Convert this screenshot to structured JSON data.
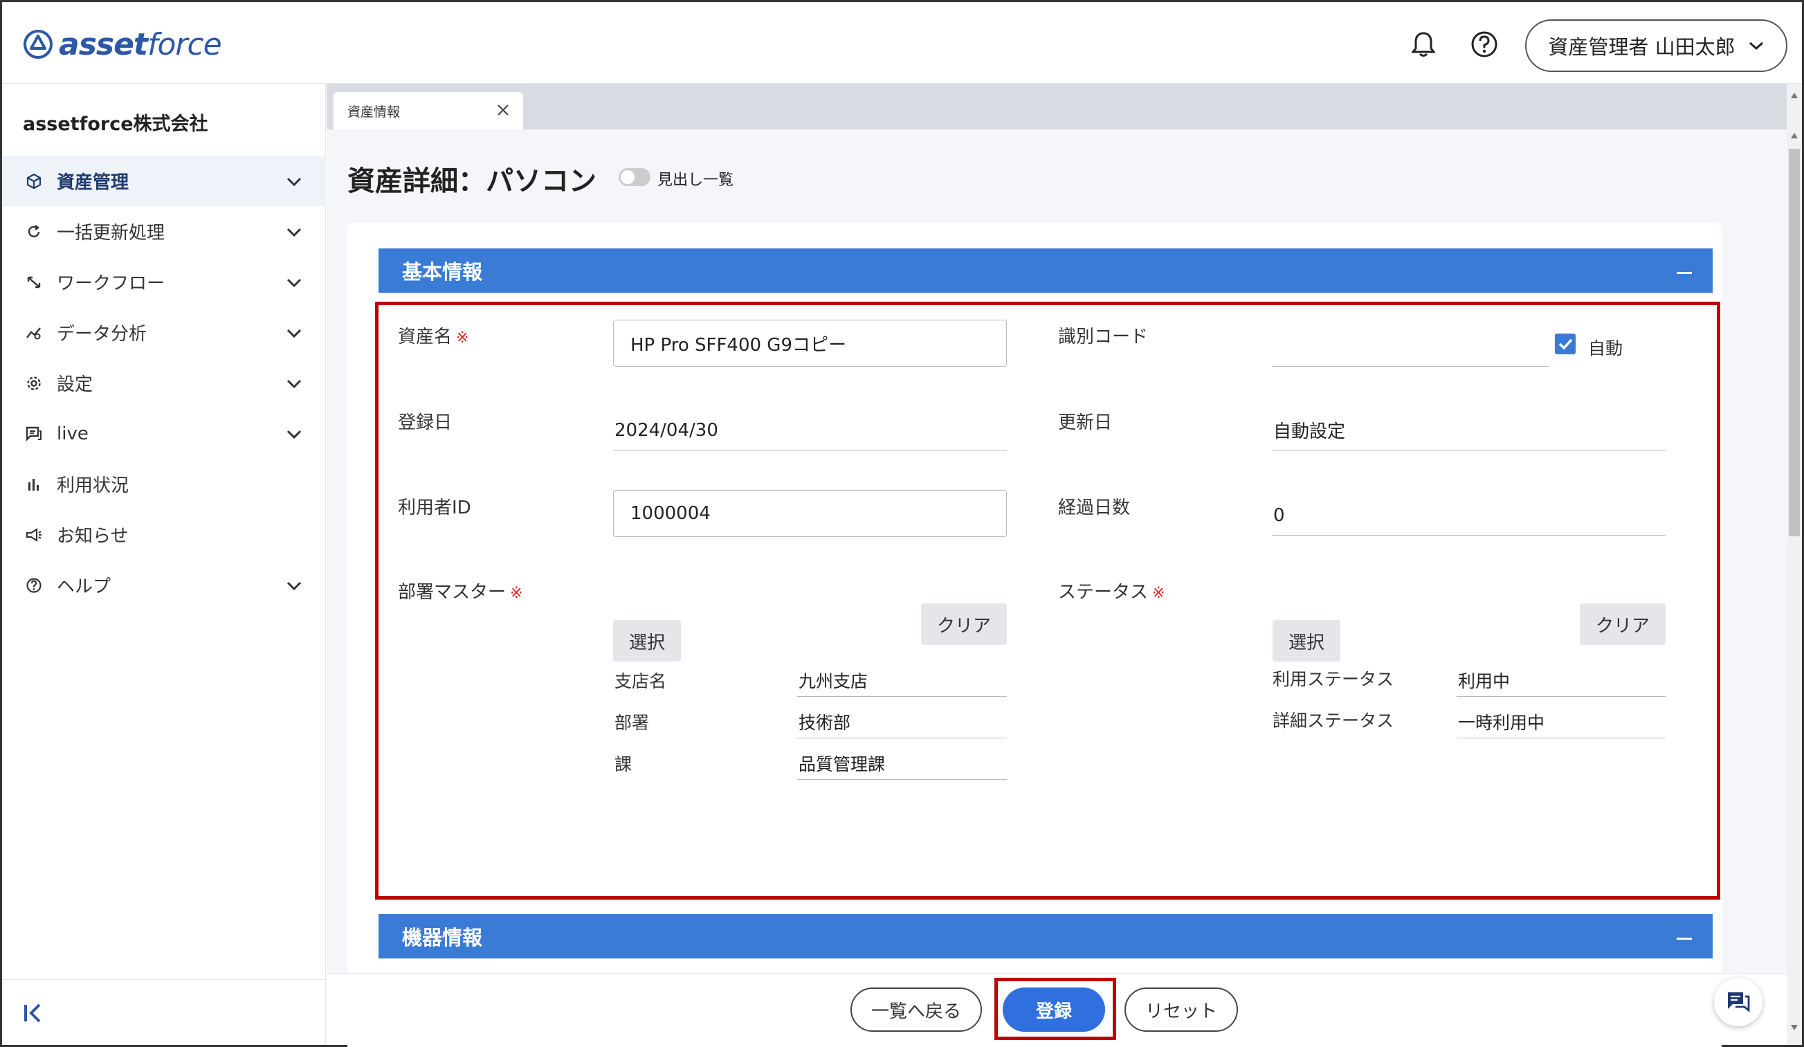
{
  "header": {
    "logo": {
      "part1": "asset",
      "part2": "force"
    },
    "user_label": "資産管理者 山田太郎"
  },
  "sidebar": {
    "company": "assetforce株式会社",
    "items": [
      {
        "label": "資産管理",
        "icon": "box-icon",
        "active": true,
        "expandable": true
      },
      {
        "label": "一括更新処理",
        "icon": "refresh-icon",
        "active": false,
        "expandable": true
      },
      {
        "label": "ワークフロー",
        "icon": "workflow-icon",
        "active": false,
        "expandable": true
      },
      {
        "label": "データ分析",
        "icon": "analytics-icon",
        "active": false,
        "expandable": true
      },
      {
        "label": "設定",
        "icon": "gear-icon",
        "active": false,
        "expandable": true
      },
      {
        "label": "live",
        "icon": "chat-icon",
        "active": false,
        "expandable": true
      },
      {
        "label": "利用状況",
        "icon": "bar-chart-icon",
        "active": false,
        "expandable": false
      },
      {
        "label": "お知らせ",
        "icon": "megaphone-icon",
        "active": false,
        "expandable": false
      },
      {
        "label": "ヘルプ",
        "icon": "help-icon",
        "active": false,
        "expandable": true
      }
    ]
  },
  "tabs": [
    {
      "label": "資産情報"
    }
  ],
  "page": {
    "title": "資産詳細：パソコン",
    "toggle_label": "見出し一覧"
  },
  "sections": {
    "basic": {
      "title": "基本情報"
    },
    "device": {
      "title": "機器情報"
    }
  },
  "form": {
    "required_mark": "※",
    "asset_name": {
      "label": "資産名",
      "value": "HP Pro SFF400 G9コピー"
    },
    "id_code": {
      "label": "識別コード",
      "value": "",
      "auto_label": "自動",
      "auto_checked": true
    },
    "registered_date": {
      "label": "登録日",
      "value": "2024/04/30"
    },
    "updated_date": {
      "label": "更新日",
      "value": "自動設定"
    },
    "user_id": {
      "label": "利用者ID",
      "value": "1000004"
    },
    "elapsed_days": {
      "label": "経過日数",
      "value": "0"
    },
    "department_master": {
      "label": "部署マスター",
      "select_label": "選択",
      "clear_label": "クリア",
      "fields": [
        {
          "label": "支店名",
          "value": "九州支店"
        },
        {
          "label": "部署",
          "value": "技術部"
        },
        {
          "label": "課",
          "value": "品質管理課"
        }
      ]
    },
    "status": {
      "label": "ステータス",
      "select_label": "選択",
      "clear_label": "クリア",
      "fields": [
        {
          "label": "利用ステータス",
          "value": "利用中"
        },
        {
          "label": "詳細ステータス",
          "value": "一時利用中"
        }
      ]
    }
  },
  "footer": {
    "back_label": "一覧へ戻る",
    "register_label": "登録",
    "reset_label": "リセット"
  },
  "colors": {
    "accent": "#3a7bd5",
    "primary_button": "#2f6fde",
    "highlight": "#c00000",
    "brand": "#2d57a7"
  }
}
